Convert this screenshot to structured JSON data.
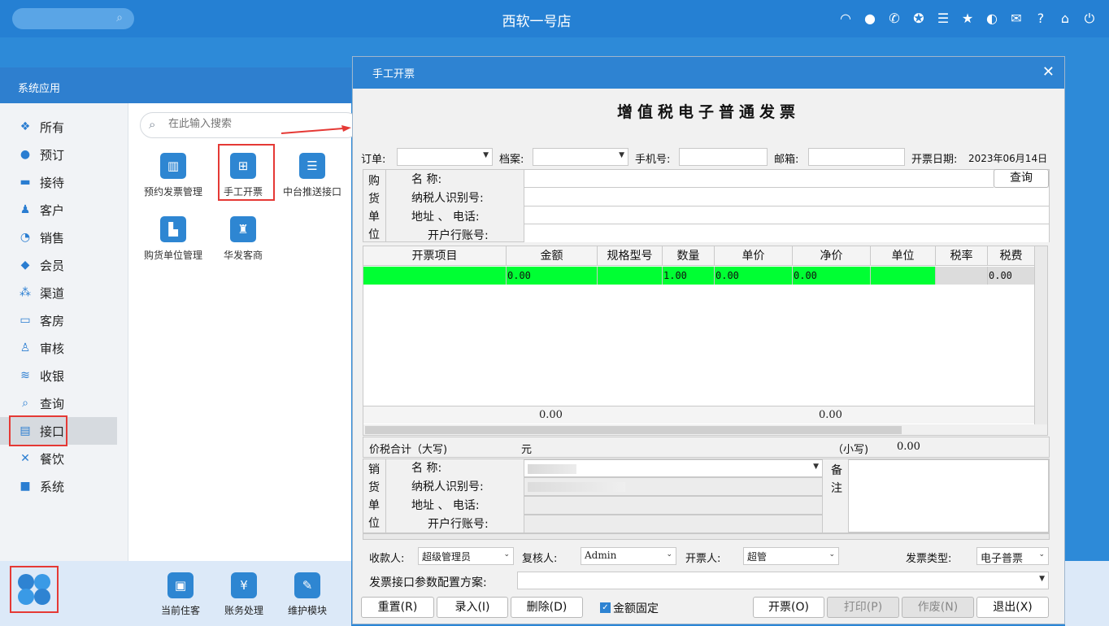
{
  "topbar": {
    "shop_name": "西软一号店",
    "icons": [
      "wifi-icon",
      "chat-icon",
      "phone-icon",
      "palette-icon",
      "menu-icon",
      "star-icon",
      "contrast-icon",
      "mail-icon",
      "help-icon",
      "home-icon",
      "power-icon"
    ]
  },
  "system_panel": {
    "title": "系统应用",
    "nav": [
      {
        "label": "所有",
        "icon": "grid-icon"
      },
      {
        "label": "预订",
        "icon": "booking-icon"
      },
      {
        "label": "接待",
        "icon": "reception-icon"
      },
      {
        "label": "客户",
        "icon": "user-icon"
      },
      {
        "label": "销售",
        "icon": "pie-icon"
      },
      {
        "label": "会员",
        "icon": "diamond-icon"
      },
      {
        "label": "渠道",
        "icon": "channel-icon"
      },
      {
        "label": "客房",
        "icon": "bed-icon"
      },
      {
        "label": "审核",
        "icon": "stamp-icon"
      },
      {
        "label": "收银",
        "icon": "coins-icon"
      },
      {
        "label": "查询",
        "icon": "search-icon"
      },
      {
        "label": "接口",
        "icon": "interface-icon"
      },
      {
        "label": "餐饮",
        "icon": "cutlery-icon"
      },
      {
        "label": "系统",
        "icon": "system-icon"
      }
    ],
    "search_placeholder": "在此输入搜索",
    "apps": [
      {
        "label": "预约发票管理"
      },
      {
        "label": "手工开票"
      },
      {
        "label": "中台推送接口"
      },
      {
        "label": "购货单位管理"
      },
      {
        "label": "华发客商"
      }
    ]
  },
  "dock": {
    "items": [
      {
        "label": "当前住客"
      },
      {
        "label": "账务处理"
      },
      {
        "label": "维护模块"
      }
    ]
  },
  "dialog": {
    "title": "手工开票",
    "invoice_title": "增值税电子普通发票",
    "order_label": "订单:",
    "order_value": "",
    "archive_label": "档案:",
    "archive_value": "",
    "phone_label": "手机号:",
    "phone_value": "",
    "email_label": "邮箱:",
    "email_value": "",
    "issue_date_label": "开票日期:",
    "issue_date_value": "2023年06月14日",
    "buyer": {
      "side": [
        "购",
        "货",
        "单",
        "位"
      ],
      "name_label": "名      称:",
      "tax_id_label": "纳税人识别号:",
      "address_label": "地址 、 电话:",
      "bank_label": "开户行账号:",
      "query_button": "查询"
    },
    "grid": {
      "columns": [
        "开票项目",
        "金额",
        "规格型号",
        "数量",
        "单价",
        "净价",
        "单位",
        "税率",
        "税费"
      ],
      "row": [
        "",
        "0.00",
        "",
        "1.00",
        "0.00",
        "0.00",
        "",
        "",
        "0.00"
      ],
      "totals": {
        "amount": "0.00",
        "net": "0.00"
      }
    },
    "total_caps_label": "价税合计（大写)",
    "total_caps_value": "元",
    "total_small_label": "（小写)",
    "total_small_value": "0.00",
    "seller": {
      "side": [
        "销",
        "货",
        "单",
        "位"
      ],
      "name_label": "名      称:",
      "tax_id_label": "纳税人识别号:",
      "address_label": "地址 、 电话:",
      "bank_label": "开户行账号:",
      "remark_label": [
        "备",
        "注"
      ]
    },
    "payee_label": "收款人:",
    "payee_value": "超级管理员",
    "reviewer_label": "复核人:",
    "reviewer_value": "Admin",
    "drawer_label": "开票人:",
    "drawer_value": "超管",
    "invoice_type_label": "发票类型:",
    "invoice_type_value": "电子普票",
    "config_label": "发票接口参数配置方案:",
    "config_value": "",
    "buttons": {
      "reset": "重置(R)",
      "entry": "录入(I)",
      "delete": "删除(D)",
      "amount_fixed": "金额固定",
      "issue": "开票(O)",
      "print": "打印(P)",
      "void": "作废(N)",
      "exit": "退出(X)"
    }
  },
  "colors": {
    "accent": "#2e83d2",
    "row_highlight": "#00ff33",
    "annotation_red": "#e53935"
  }
}
